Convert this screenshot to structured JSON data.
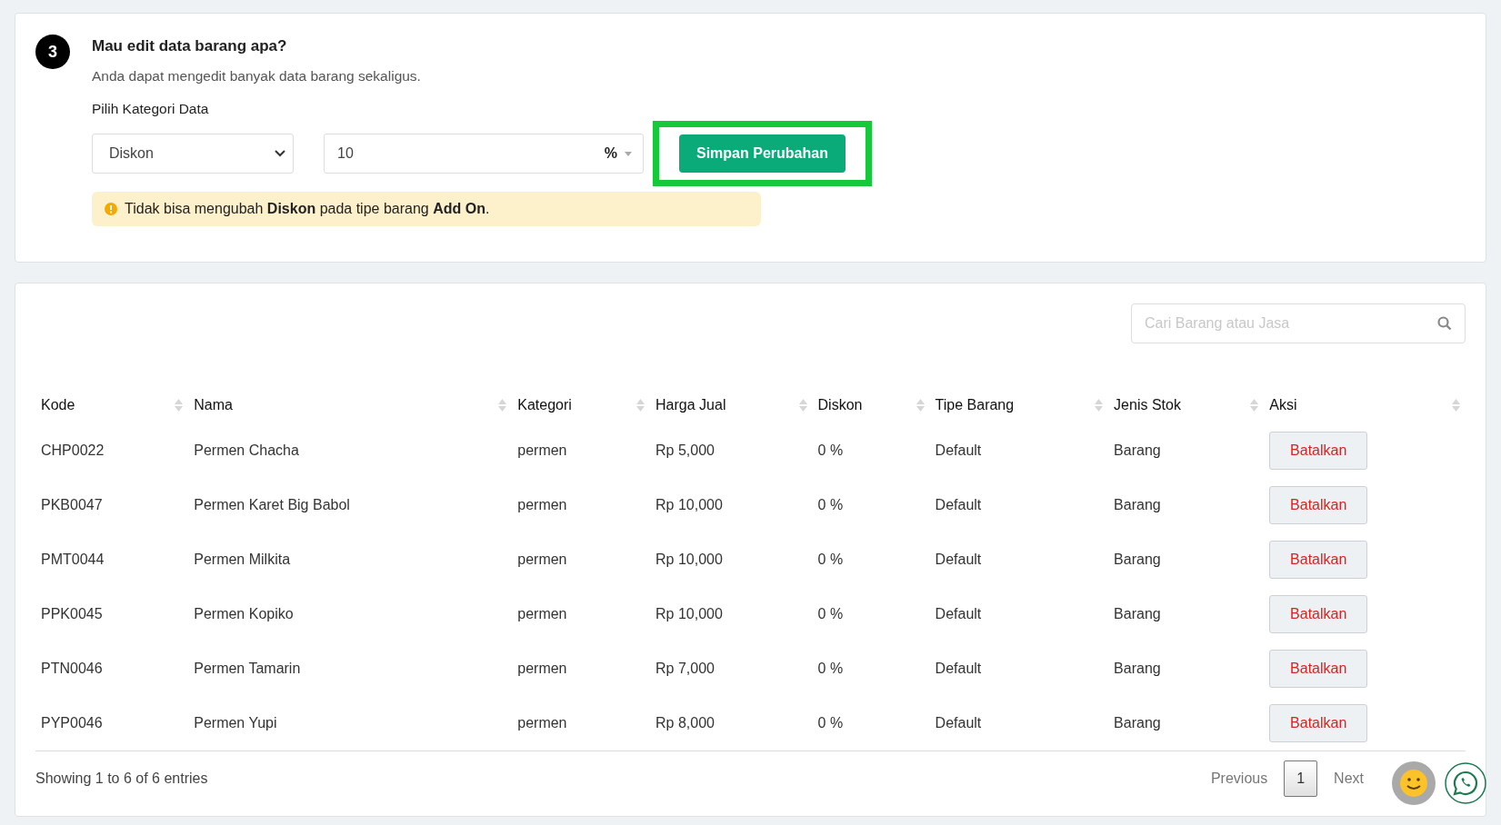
{
  "editor": {
    "step": "3",
    "title": "Mau edit data barang apa?",
    "subtitle": "Anda dapat mengedit banyak data barang sekaligus.",
    "field_label": "Pilih Kategori Data",
    "category_select": {
      "value": "Diskon"
    },
    "amount_field": {
      "value": "10",
      "unit": "%"
    },
    "save_button": {
      "label": "Simpan Perubahan",
      "highlighted": true
    },
    "warning": "Tidak bisa mengubah **Diskon** pada tipe barang **Add On**."
  },
  "table": {
    "search": {
      "placeholder": "Cari Barang atau Jasa"
    },
    "columns": [
      "Kode",
      "Nama",
      "Kategori",
      "Harga Jual",
      "Diskon",
      "Tipe Barang",
      "Jenis Stok",
      "Aksi"
    ],
    "rows": [
      {
        "cells": [
          "CHP0022",
          "Permen Chacha",
          "permen",
          "Rp 5,000",
          "0 %",
          "Default",
          "Barang"
        ],
        "action": "Batalkan"
      },
      {
        "cells": [
          "PKB0047",
          "Permen Karet Big Babol",
          "permen",
          "Rp 10,000",
          "0 %",
          "Default",
          "Barang"
        ],
        "action": "Batalkan"
      },
      {
        "cells": [
          "PMT0044",
          "Permen Milkita",
          "permen",
          "Rp 10,000",
          "0 %",
          "Default",
          "Barang"
        ],
        "action": "Batalkan"
      },
      {
        "cells": [
          "PPK0045",
          "Permen Kopiko",
          "permen",
          "Rp 10,000",
          "0 %",
          "Default",
          "Barang"
        ],
        "action": "Batalkan"
      },
      {
        "cells": [
          "PTN0046",
          "Permen Tamarin",
          "permen",
          "Rp 7,000",
          "0 %",
          "Default",
          "Barang"
        ],
        "action": "Batalkan"
      },
      {
        "cells": [
          "PYP0046",
          "Permen Yupi",
          "permen",
          "Rp 8,000",
          "0 %",
          "Default",
          "Barang"
        ],
        "action": "Batalkan"
      }
    ],
    "info": "Showing 1 to 6 of 6 entries",
    "pagination": {
      "previous": {
        "label": "Previous",
        "disabled": true
      },
      "pages": [
        {
          "label": "1",
          "selected": true
        }
      ],
      "next": {
        "label": "Next",
        "disabled": true
      }
    }
  }
}
